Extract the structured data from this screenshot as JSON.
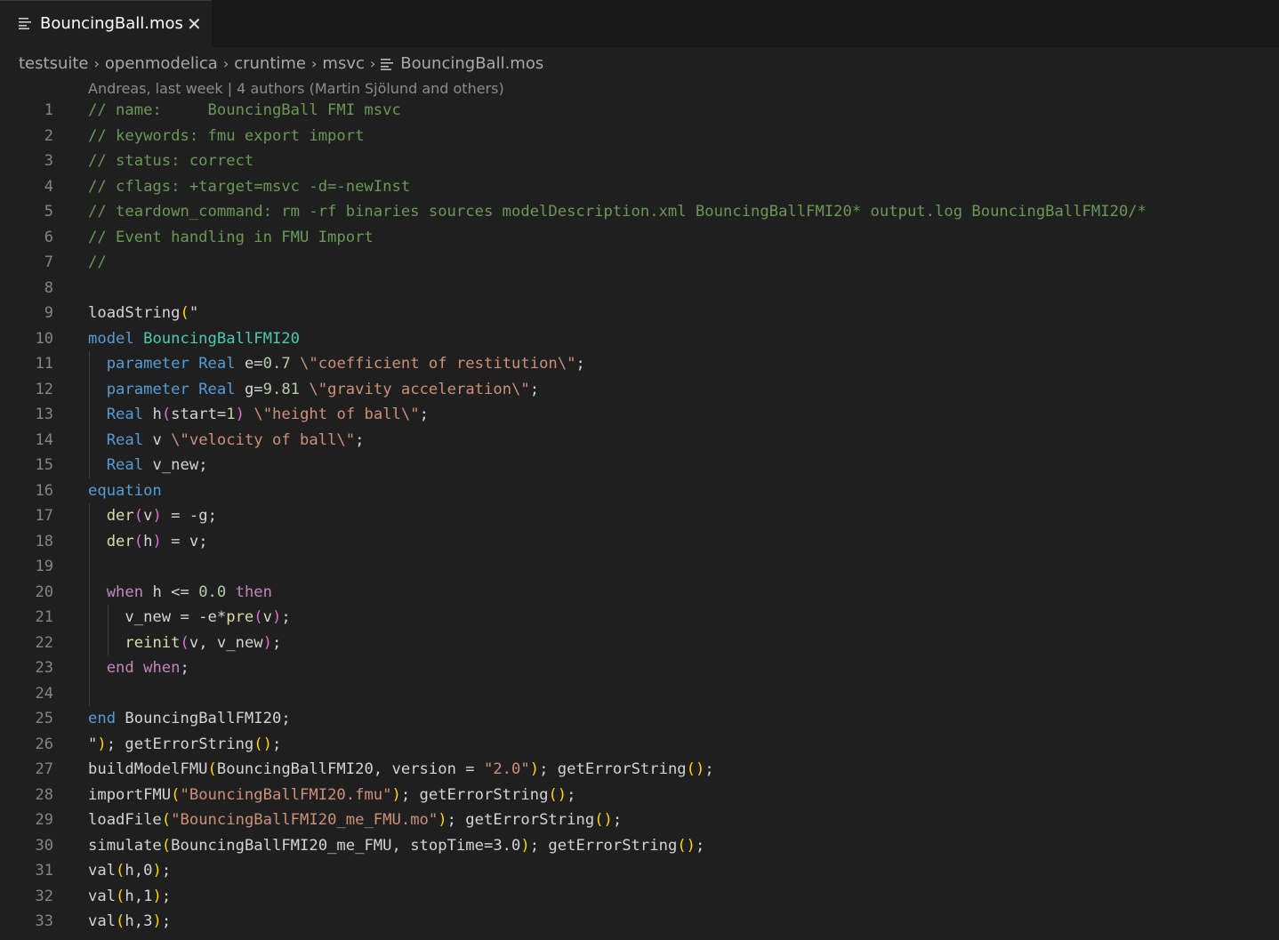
{
  "tab": {
    "label": "BouncingBall.mos",
    "close_glyph": "✕"
  },
  "breadcrumb": {
    "items": [
      "testsuite",
      "openmodelica",
      "cruntime",
      "msvc",
      "BouncingBall.mos"
    ],
    "separator": "›"
  },
  "blame": "Andreas, last week | 4 authors (Martin Sjölund and others)",
  "theme": {
    "comment": "#6a9955",
    "keyword": "#569cd6",
    "control": "#c586c0",
    "type": "#4ec9b0",
    "string": "#ce9178",
    "number": "#b5cea8",
    "function": "#dcdcaa",
    "bracket1": "#ffd700",
    "bracket2": "#da70d6"
  },
  "lines": [
    {
      "n": "1",
      "t": [
        [
          "com",
          "// name:     BouncingBall FMI msvc"
        ]
      ]
    },
    {
      "n": "2",
      "t": [
        [
          "com",
          "// keywords: fmu export import"
        ]
      ]
    },
    {
      "n": "3",
      "t": [
        [
          "com",
          "// status: correct"
        ]
      ]
    },
    {
      "n": "4",
      "t": [
        [
          "com",
          "// cflags: +target=msvc -d=-newInst"
        ]
      ]
    },
    {
      "n": "5",
      "t": [
        [
          "com",
          "// teardown_command: rm -rf binaries sources modelDescription.xml BouncingBallFMI20* output.log BouncingBallFMI20/*"
        ]
      ]
    },
    {
      "n": "6",
      "t": [
        [
          "com",
          "// Event handling in FMU Import"
        ]
      ]
    },
    {
      "n": "7",
      "t": [
        [
          "com",
          "//"
        ]
      ]
    },
    {
      "n": "8",
      "t": []
    },
    {
      "n": "9",
      "t": [
        [
          "plain",
          "loadString"
        ],
        [
          "br1",
          "("
        ],
        [
          "plain",
          "\""
        ]
      ]
    },
    {
      "n": "10",
      "t": [
        [
          "kw",
          "model "
        ],
        [
          "type",
          "BouncingBallFMI20"
        ]
      ]
    },
    {
      "n": "11",
      "t": [
        [
          "plain",
          "  "
        ],
        [
          "kw",
          "parameter "
        ],
        [
          "kw",
          "Real "
        ],
        [
          "plain",
          "e="
        ],
        [
          "num",
          "0.7"
        ],
        [
          "plain",
          " "
        ],
        [
          "str",
          "\\\"coefficient of restitution\\\""
        ],
        [
          "plain",
          ";"
        ]
      ]
    },
    {
      "n": "12",
      "t": [
        [
          "plain",
          "  "
        ],
        [
          "kw",
          "parameter "
        ],
        [
          "kw",
          "Real "
        ],
        [
          "plain",
          "g="
        ],
        [
          "num",
          "9.81"
        ],
        [
          "plain",
          " "
        ],
        [
          "str",
          "\\\"gravity acceleration\\\""
        ],
        [
          "plain",
          ";"
        ]
      ]
    },
    {
      "n": "13",
      "t": [
        [
          "plain",
          "  "
        ],
        [
          "kw",
          "Real "
        ],
        [
          "plain",
          "h"
        ],
        [
          "br2",
          "("
        ],
        [
          "plain",
          "start="
        ],
        [
          "num",
          "1"
        ],
        [
          "br2",
          ")"
        ],
        [
          "plain",
          " "
        ],
        [
          "str",
          "\\\"height of ball\\\""
        ],
        [
          "plain",
          ";"
        ]
      ]
    },
    {
      "n": "14",
      "t": [
        [
          "plain",
          "  "
        ],
        [
          "kw",
          "Real "
        ],
        [
          "plain",
          "v "
        ],
        [
          "str",
          "\\\"velocity of ball\\\""
        ],
        [
          "plain",
          ";"
        ]
      ]
    },
    {
      "n": "15",
      "t": [
        [
          "plain",
          "  "
        ],
        [
          "kw",
          "Real "
        ],
        [
          "plain",
          "v_new;"
        ]
      ]
    },
    {
      "n": "16",
      "t": [
        [
          "kw",
          "equation"
        ]
      ]
    },
    {
      "n": "17",
      "t": [
        [
          "plain",
          "  "
        ],
        [
          "fn",
          "der"
        ],
        [
          "br2",
          "("
        ],
        [
          "plain",
          "v"
        ],
        [
          "br2",
          ")"
        ],
        [
          "plain",
          " = -g;"
        ]
      ]
    },
    {
      "n": "18",
      "t": [
        [
          "plain",
          "  "
        ],
        [
          "fn",
          "der"
        ],
        [
          "br2",
          "("
        ],
        [
          "plain",
          "h"
        ],
        [
          "br2",
          ")"
        ],
        [
          "plain",
          " = v;"
        ]
      ]
    },
    {
      "n": "19",
      "t": []
    },
    {
      "n": "20",
      "t": [
        [
          "plain",
          "  "
        ],
        [
          "ctl",
          "when "
        ],
        [
          "plain",
          "h <= "
        ],
        [
          "num",
          "0.0"
        ],
        [
          "plain",
          " "
        ],
        [
          "ctl",
          "then"
        ]
      ]
    },
    {
      "n": "21",
      "t": [
        [
          "plain",
          "    v_new = -e*"
        ],
        [
          "fn",
          "pre"
        ],
        [
          "br2",
          "("
        ],
        [
          "plain",
          "v"
        ],
        [
          "br2",
          ")"
        ],
        [
          "plain",
          ";"
        ]
      ]
    },
    {
      "n": "22",
      "t": [
        [
          "plain",
          "    "
        ],
        [
          "fn",
          "reinit"
        ],
        [
          "br2",
          "("
        ],
        [
          "plain",
          "v, v_new"
        ],
        [
          "br2",
          ")"
        ],
        [
          "plain",
          ";"
        ]
      ]
    },
    {
      "n": "23",
      "t": [
        [
          "plain",
          "  "
        ],
        [
          "ctl",
          "end when"
        ],
        [
          "plain",
          ";"
        ]
      ]
    },
    {
      "n": "24",
      "t": []
    },
    {
      "n": "25",
      "t": [
        [
          "kw",
          "end "
        ],
        [
          "plain",
          "BouncingBallFMI20;"
        ]
      ]
    },
    {
      "n": "26",
      "t": [
        [
          "plain",
          "\""
        ],
        [
          "br1",
          ")"
        ],
        [
          "plain",
          "; getErrorString"
        ],
        [
          "br1",
          "()"
        ],
        [
          "plain",
          ";"
        ]
      ]
    },
    {
      "n": "27",
      "t": [
        [
          "plain",
          "buildModelFMU"
        ],
        [
          "br1",
          "("
        ],
        [
          "plain",
          "BouncingBallFMI20, version = "
        ],
        [
          "str",
          "\"2.0\""
        ],
        [
          "br1",
          ")"
        ],
        [
          "plain",
          "; getErrorString"
        ],
        [
          "br1",
          "()"
        ],
        [
          "plain",
          ";"
        ]
      ]
    },
    {
      "n": "28",
      "t": [
        [
          "plain",
          "importFMU"
        ],
        [
          "br1",
          "("
        ],
        [
          "str",
          "\"BouncingBallFMI20.fmu\""
        ],
        [
          "br1",
          ")"
        ],
        [
          "plain",
          "; getErrorString"
        ],
        [
          "br1",
          "()"
        ],
        [
          "plain",
          ";"
        ]
      ]
    },
    {
      "n": "29",
      "t": [
        [
          "plain",
          "loadFile"
        ],
        [
          "br1",
          "("
        ],
        [
          "str",
          "\"BouncingBallFMI20_me_FMU.mo\""
        ],
        [
          "br1",
          ")"
        ],
        [
          "plain",
          "; getErrorString"
        ],
        [
          "br1",
          "()"
        ],
        [
          "plain",
          ";"
        ]
      ]
    },
    {
      "n": "30",
      "t": [
        [
          "plain",
          "simulate"
        ],
        [
          "br1",
          "("
        ],
        [
          "plain",
          "BouncingBallFMI20_me_FMU, stopTime=3.0"
        ],
        [
          "br1",
          ")"
        ],
        [
          "plain",
          "; getErrorString"
        ],
        [
          "br1",
          "()"
        ],
        [
          "plain",
          ";"
        ]
      ]
    },
    {
      "n": "31",
      "t": [
        [
          "plain",
          "val"
        ],
        [
          "br1",
          "("
        ],
        [
          "plain",
          "h,0"
        ],
        [
          "br1",
          ")"
        ],
        [
          "plain",
          ";"
        ]
      ]
    },
    {
      "n": "32",
      "t": [
        [
          "plain",
          "val"
        ],
        [
          "br1",
          "("
        ],
        [
          "plain",
          "h,1"
        ],
        [
          "br1",
          ")"
        ],
        [
          "plain",
          ";"
        ]
      ]
    },
    {
      "n": "33",
      "t": [
        [
          "plain",
          "val"
        ],
        [
          "br1",
          "("
        ],
        [
          "plain",
          "h,3"
        ],
        [
          "br1",
          ")"
        ],
        [
          "plain",
          ";"
        ]
      ]
    }
  ]
}
